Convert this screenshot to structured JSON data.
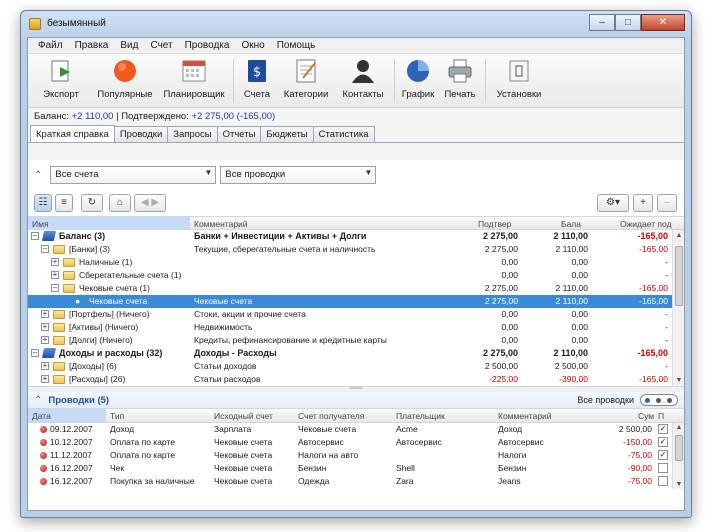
{
  "window": {
    "title": "безымянный"
  },
  "menu": [
    "Файл",
    "Правка",
    "Вид",
    "Счет",
    "Проводка",
    "Окно",
    "Помощь"
  ],
  "toolbar": [
    {
      "label": "Экспорт",
      "icon": "export-icon"
    },
    {
      "label": "Популярные",
      "icon": "heart-icon"
    },
    {
      "label": "Планировщик",
      "icon": "calendar-icon"
    },
    {
      "label": "Счета",
      "icon": "dollar-book-icon"
    },
    {
      "label": "Категории",
      "icon": "notepad-icon"
    },
    {
      "label": "Контакты",
      "icon": "person-icon"
    },
    {
      "label": "График",
      "icon": "pie-chart-icon"
    },
    {
      "label": "Печать",
      "icon": "printer-icon"
    },
    {
      "label": "Установки",
      "icon": "settings-icon"
    }
  ],
  "status": {
    "balance_label": "Баланс:",
    "balance_value": "+2 110,00",
    "confirmed_label": "Подтверждено:",
    "confirmed_value": "+2 275,00 (-165,00)"
  },
  "tabs": [
    "Краткая справка",
    "Проводки",
    "Запросы",
    "Отчеты",
    "Бюджеты",
    "Статистика"
  ],
  "filters": {
    "accounts": "Все счета",
    "transactions": "Все проводки"
  },
  "grid": {
    "headers": [
      "Имя",
      "Комментарий",
      "Подтвер",
      "Бала",
      "Ожидает под"
    ],
    "rows": [
      {
        "name": "Баланс (3)",
        "comment": "Банки + Инвестиции + Активы + Долги",
        "confirmed": "2 275,00",
        "balance": "2 110,00",
        "pending": "-165,00"
      },
      {
        "name": "[Банки] (3)",
        "comment": "Текущие, сберегательные счета и наличность",
        "confirmed": "2 275,00",
        "balance": "2 110,00",
        "pending": "-165,00"
      },
      {
        "name": "Наличные (1)",
        "comment": "",
        "confirmed": "0,00",
        "balance": "0,00",
        "pending": "-"
      },
      {
        "name": "Сберегательные счета (1)",
        "comment": "",
        "confirmed": "0,00",
        "balance": "0,00",
        "pending": "-"
      },
      {
        "name": "Чековые счета (1)",
        "comment": "",
        "confirmed": "2 275,00",
        "balance": "2 110,00",
        "pending": "-165,00"
      },
      {
        "name": "Чековые счета",
        "comment": "Чековые счета",
        "confirmed": "2 275,00",
        "balance": "2 110,00",
        "pending": "-165,00"
      },
      {
        "name": "[Портфель] (Ничего)",
        "comment": "Стоки, акции и прочие счета",
        "confirmed": "0,00",
        "balance": "0,00",
        "pending": "-"
      },
      {
        "name": "[Активы] (Ничего)",
        "comment": "Недвижимость",
        "confirmed": "0,00",
        "balance": "0,00",
        "pending": "-"
      },
      {
        "name": "[Долги] (Ничего)",
        "comment": "Кредиты, рефинансирование и кредитные карты",
        "confirmed": "0,00",
        "balance": "0,00",
        "pending": "-"
      },
      {
        "name": "Доходы и расходы (32)",
        "comment": "Доходы - Расходы",
        "confirmed": "2 275,00",
        "balance": "2 110,00",
        "pending": "-165,00"
      },
      {
        "name": "[Доходы] (6)",
        "comment": "Статьи доходов",
        "confirmed": "2 500,00",
        "balance": "2 500,00",
        "pending": "-"
      },
      {
        "name": "[Расходы] (26)",
        "comment": "Статьи расходов",
        "confirmed": "-225,00",
        "balance": "-390,00",
        "pending": "-165,00"
      }
    ]
  },
  "transactions": {
    "title": "Проводки (5)",
    "filter": "Все проводки",
    "headers": [
      "Дата",
      "Тип",
      "Исходный счет",
      "Счет получателя",
      "Плательщик",
      "Комментарий",
      "Сум",
      "П"
    ],
    "rows": [
      {
        "date": "09.12.2007",
        "type": "Доход",
        "from": "Зарплата",
        "to": "Чековые счета",
        "payee": "Acme",
        "comment": "Доход",
        "sum": "2 500,00",
        "checked": "✓"
      },
      {
        "date": "10.12.2007",
        "type": "Оплата по карте",
        "from": "Чековые счета",
        "to": "Автосервис",
        "payee": "Автосервис",
        "comment": "Автосервис",
        "sum": "-150,00",
        "checked": "✓"
      },
      {
        "date": "11.12.2007",
        "type": "Оплата по карте",
        "from": "Чековые счета",
        "to": "Налоги на авто",
        "payee": "",
        "comment": "Налоги",
        "sum": "-75,00",
        "checked": "✓"
      },
      {
        "date": "16.12.2007",
        "type": "Чек",
        "from": "Чековые счета",
        "to": "Бензин",
        "payee": "Shell",
        "comment": "Бензин",
        "sum": "-90,00",
        "checked": ""
      },
      {
        "date": "16.12.2007",
        "type": "Покупка за наличные",
        "from": "Чековые счета",
        "to": "Одежда",
        "payee": "Zara",
        "comment": "Jeans",
        "sum": "-75,00",
        "checked": ""
      }
    ]
  },
  "colors": {
    "accent": "#3b8ad8",
    "negative": "#cc0000",
    "link": "#1a3aa8"
  }
}
